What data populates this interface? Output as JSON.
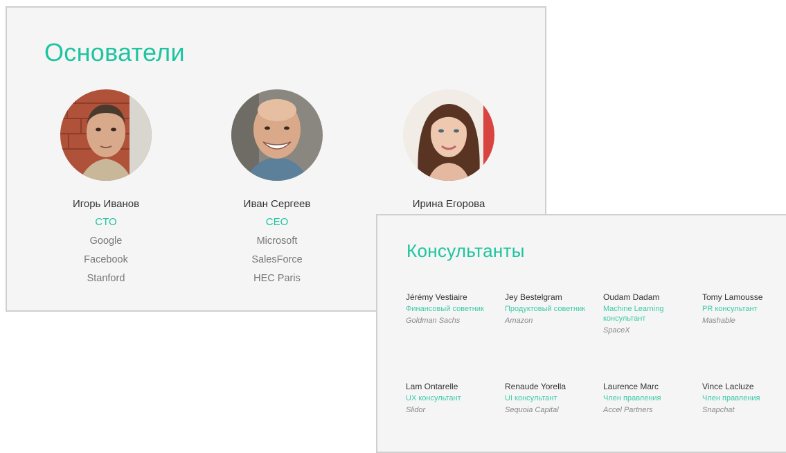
{
  "founders": {
    "title": "Основатели",
    "people": [
      {
        "name": "Игорь Иванов",
        "role": "CTO",
        "lines": [
          "Google",
          "Facebook",
          "Stanford"
        ]
      },
      {
        "name": "Иван Сергеев",
        "role": "CEO",
        "lines": [
          "Microsoft",
          "SalesForce",
          "HEC Paris"
        ]
      },
      {
        "name": "Ирина Егорова",
        "role": "",
        "lines": []
      }
    ]
  },
  "consultants": {
    "title": "Консультанты",
    "people": [
      {
        "name": "Jérémy Vestiaire",
        "role": "Финансовый советник",
        "company": "Goldman Sachs"
      },
      {
        "name": "Jey Bestelgram",
        "role": "Продуктовый советник",
        "company": "Amazon"
      },
      {
        "name": "Oudam Dadam",
        "role": "Machine Learning консультант",
        "company": "SpaceX"
      },
      {
        "name": "Tomy Lamousse",
        "role": "PR консультант",
        "company": "Mashable"
      },
      {
        "name": "Lam Ontarelle",
        "role": "UX консультант",
        "company": "Slidor"
      },
      {
        "name": "Renaude Yorella",
        "role": "UI консультант",
        "company": "Sequoia Capital"
      },
      {
        "name": "Laurence Marc",
        "role": "Член правления",
        "company": "Accel Partners"
      },
      {
        "name": "Vince Lacluze",
        "role": "Член правления",
        "company": "Snapchat"
      }
    ]
  },
  "colors": {
    "accent": "#1ec4a0",
    "card_bg": "#f5f5f5",
    "card_border": "#cfcfcf"
  }
}
